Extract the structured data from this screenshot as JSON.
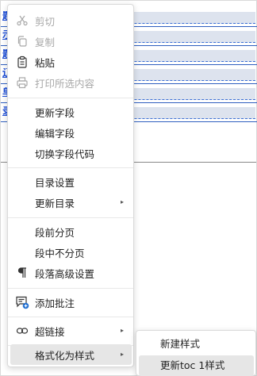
{
  "document": {
    "fragments": [
      "题",
      "示",
      "题",
      "辽",
      "单",
      "录"
    ]
  },
  "context_menu": {
    "items": [
      {
        "label": "剪切",
        "icon": "scissors-icon",
        "disabled": true
      },
      {
        "label": "复制",
        "icon": "copy-icon",
        "disabled": true
      },
      {
        "label": "粘贴",
        "icon": "clipboard-icon",
        "disabled": false
      },
      {
        "label": "打印所选内容",
        "icon": "printer-icon",
        "disabled": true
      },
      {
        "label": "更新字段",
        "disabled": false
      },
      {
        "label": "编辑字段",
        "disabled": false
      },
      {
        "label": "切换字段代码",
        "disabled": false
      },
      {
        "label": "目录设置",
        "disabled": false
      },
      {
        "label": "更新目录",
        "submenu": true
      },
      {
        "label": "段前分页",
        "disabled": false
      },
      {
        "label": "段中不分页",
        "disabled": false
      },
      {
        "label": "段落高级设置",
        "icon": "pilcrow-icon",
        "disabled": false
      },
      {
        "label": "添加批注",
        "icon": "add-comment-icon",
        "disabled": false
      },
      {
        "label": "超链接",
        "icon": "link-icon",
        "submenu": true
      },
      {
        "label": "格式化为样式",
        "submenu": true,
        "selected": true
      }
    ],
    "submenu_arrow": "▸"
  },
  "style_submenu": {
    "items": [
      {
        "label": "新建样式"
      },
      {
        "label": "更新toc 1样式",
        "selected": true
      }
    ]
  },
  "colors": {
    "link_blue": "#1d4ed8",
    "disabled_gray": "#a8a8a8",
    "hover_gray": "#e6e6e6"
  }
}
